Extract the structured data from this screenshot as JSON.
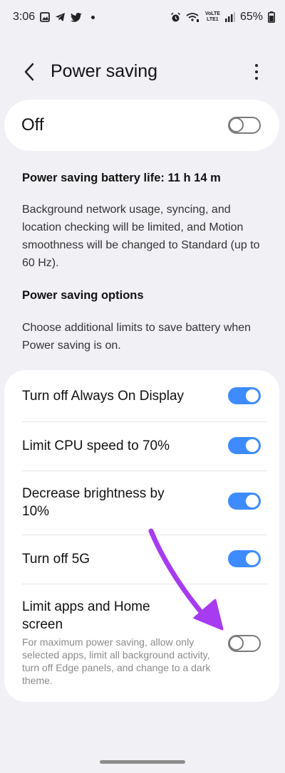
{
  "status_bar": {
    "time": "3:06",
    "battery": "65%",
    "network_tag_top": "VoLTE",
    "network_tag_bottom": "LTE1"
  },
  "header": {
    "title": "Power saving"
  },
  "master_switch": {
    "label": "Off",
    "state": "off"
  },
  "info": {
    "battery_life": "Power saving battery life: 11 h 14 m",
    "description": "Background network usage, syncing, and location checking will be limited, and Motion smoothness will be changed to Standard (up to 60 Hz).",
    "options_heading": "Power saving options",
    "options_description": "Choose additional limits to save battery when Power saving is on."
  },
  "options": [
    {
      "label": "Turn off Always On Display",
      "state": "on"
    },
    {
      "label": "Limit CPU speed to 70%",
      "state": "on"
    },
    {
      "label": "Decrease brightness by 10%",
      "state": "on"
    },
    {
      "label": "Turn off 5G",
      "state": "on"
    },
    {
      "label": "Limit apps and Home screen",
      "sub": "For maximum power saving, allow only selected apps, limit all background activity, turn off Edge panels, and change to a dark theme.",
      "state": "off"
    }
  ],
  "colors": {
    "accent": "#3e8bff",
    "annotation_arrow": "#a63bf0"
  }
}
